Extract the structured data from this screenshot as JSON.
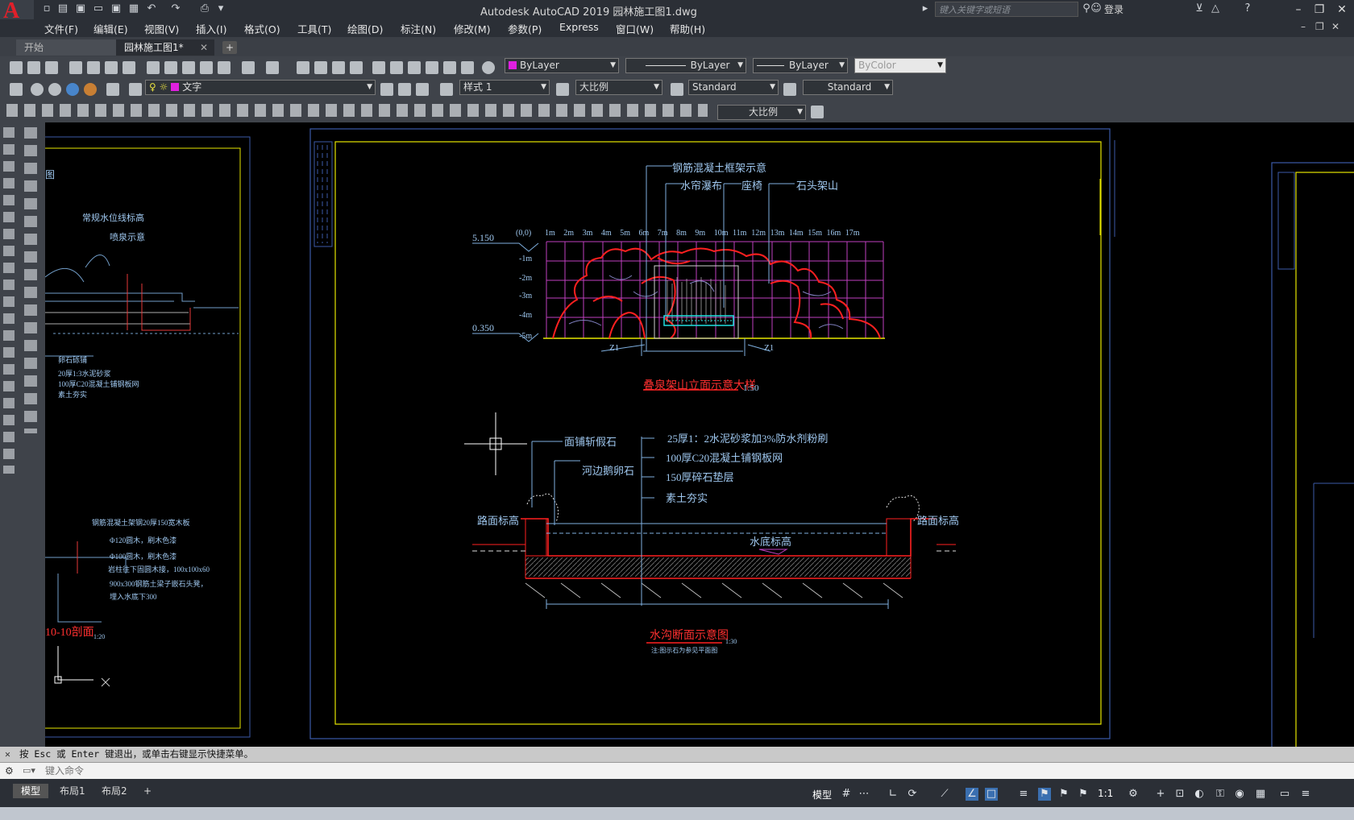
{
  "window": {
    "title": "Autodesk AutoCAD 2019    园林施工图1.dwg",
    "search_placeholder": "键入关键字或短语",
    "login": "登录",
    "logo_letter": "A"
  },
  "menu": [
    "文件(F)",
    "编辑(E)",
    "视图(V)",
    "插入(I)",
    "格式(O)",
    "工具(T)",
    "绘图(D)",
    "标注(N)",
    "修改(M)",
    "参数(P)",
    "Express",
    "窗口(W)",
    "帮助(H)"
  ],
  "tabs": [
    {
      "label": "开始"
    },
    {
      "label": "园林施工图1*"
    }
  ],
  "properties": {
    "color": "ByLayer",
    "linetype": "ByLayer",
    "lineweight": "ByLayer",
    "plotstyle": "ByColor",
    "layer": "文字",
    "text_style": "样式 1",
    "dim_style": "大比例",
    "table_style": "Standard",
    "mleader_style": "Standard",
    "scale": "大比例"
  },
  "drawing": {
    "elev_title": "叠泉架山立面示意大样",
    "elev_scale": "1:50",
    "callouts_top": [
      "钢筋混凝土框架示意",
      "水帘瀑布",
      "座椅",
      "石头架山"
    ],
    "grid_cols": [
      "(0,0)",
      "1m",
      "2m",
      "3m",
      "4m",
      "5m",
      "6m",
      "7m",
      "8m",
      "9m",
      "10m",
      "11m",
      "12m",
      "13m",
      "14m",
      "15m",
      "16m",
      "17m"
    ],
    "grid_rows": [
      "-1m",
      "-2m",
      "-3m",
      "-4m",
      "-5m"
    ],
    "level_top": "5.150",
    "level_bottom": "0.350",
    "z_left": "Z1",
    "z_right": "Z1",
    "section_title": "水沟断面示意图",
    "section_scale": "1:30",
    "section_note": "注:图示石为参见平面图",
    "section_labels": [
      "面铺斩假石",
      "河边鹅卵石"
    ],
    "section_layers": [
      "25厚1：2水泥砂浆加3%防水剂粉刷",
      "100厚C20混凝土铺钢板网",
      "150厚碎石垫层",
      "素土夯实"
    ],
    "road_left": "路面标高",
    "road_right": "路面标高",
    "water_bottom": "水底标高",
    "left_labels": [
      "常规水位线标高",
      "喷泉示意",
      "卵石砾铺",
      "20厚1:3水泥砂浆",
      "100厚C20混凝土铺钢板网",
      "素土夯实"
    ],
    "left_labels2": [
      "钢筋混凝土架钢20厚150宽木板",
      "Φ120圆木，刷木色漆",
      "Φ100圆木，刷木色漆",
      "岩柱往下固圆木接，100x100x60",
      "900x300钢筋土梁子嵌石头凳，",
      "埋入水底下300"
    ],
    "left_section_title": "10-10剖面",
    "left_section_scale": "1:20",
    "left_top_fragment": "图"
  },
  "command": {
    "history": "按 Esc 或 Enter 键退出，或单击右键显示快捷菜单。",
    "placeholder": "键入命令"
  },
  "layout_tabs": [
    "模型",
    "布局1",
    "布局2"
  ],
  "status": {
    "model": "模型",
    "scale": "1:1"
  },
  "colors": {
    "accent_red": "#e0202a",
    "cad_frame": "#3b5aa8",
    "cad_yellow": "#e6e600",
    "cad_red": "#ff2020",
    "cad_magenta": "#c040c0",
    "cad_cyan": "#20e0e0"
  }
}
